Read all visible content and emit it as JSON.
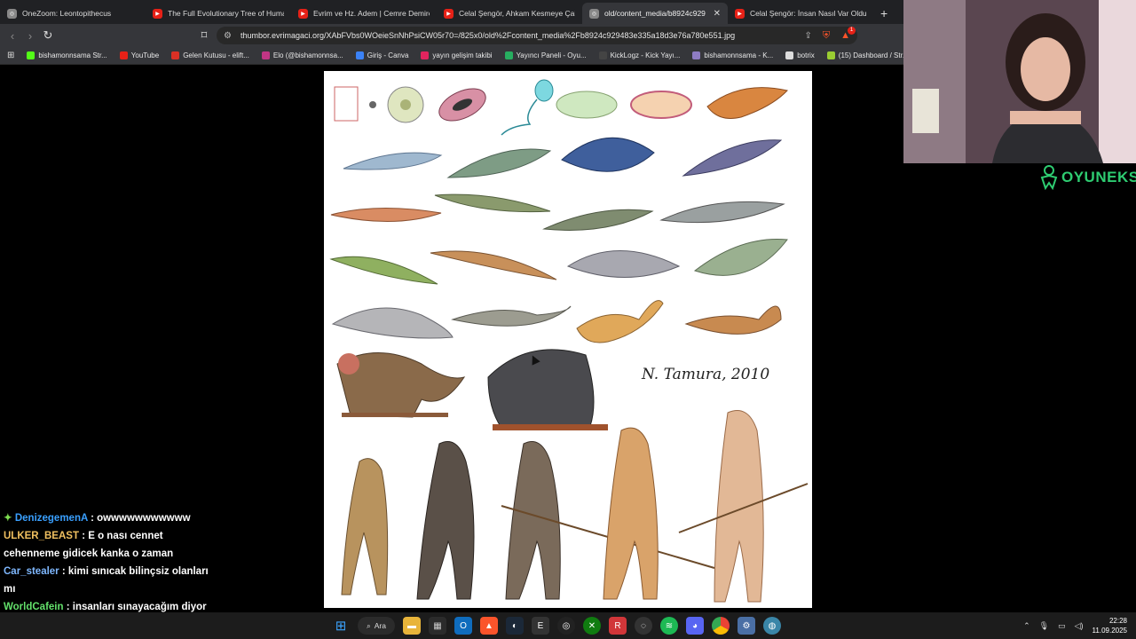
{
  "browser": {
    "tabs": [
      {
        "title": "OneZoom: Leontopithecus",
        "favicon": "onezoom-icon",
        "color": "#888888",
        "active": false
      },
      {
        "title": "The Full Evolutionary Tree of Human",
        "favicon": "youtube-icon",
        "color": "#e62117",
        "active": false
      },
      {
        "title": "Evrim ve Hz. Adem | Cemre Demirel",
        "favicon": "youtube-icon",
        "color": "#e62117",
        "active": false
      },
      {
        "title": "Celal Şengör, Ahkam Kesmeye Çalış",
        "favicon": "youtube-icon",
        "color": "#e62117",
        "active": false
      },
      {
        "title": "old/content_media/b8924c929",
        "favicon": "globe-icon",
        "color": "#888888",
        "active": true
      },
      {
        "title": "Celal Şengör: İnsan Nasıl Var Oldu?",
        "favicon": "youtube-icon",
        "color": "#e62117",
        "active": false
      }
    ],
    "url": "thumbor.evrimagaci.org/XAbFVbs0WOeieSnNhPsiCW05r70=/825x0/old%2Fcontent_media%2Fb8924c929483e335a18d3e76a780e551.jpg",
    "brave_badge": "1",
    "bookmarks": [
      {
        "label": "bishamonnsama Str...",
        "icon": "kick-icon",
        "color": "#53fc18"
      },
      {
        "label": "YouTube",
        "icon": "youtube-icon",
        "color": "#e62117"
      },
      {
        "label": "Gelen Kutusu - elift...",
        "icon": "gmail-icon",
        "color": "#d93025"
      },
      {
        "label": "Elo (@bishamonnsa...",
        "icon": "instagram-icon",
        "color": "#c13584"
      },
      {
        "label": "Giriş - Canva",
        "icon": "canva-icon",
        "color": "#3b82f6"
      },
      {
        "label": "yayın gelişim takibi",
        "icon": "heart-icon",
        "color": "#e0245e"
      },
      {
        "label": "Yayıncı Paneli - Oyu...",
        "icon": "person-icon",
        "color": "#27ae60"
      },
      {
        "label": "KickLogz - Kick Yayı...",
        "icon": "kicklogz-icon",
        "color": "#444444"
      },
      {
        "label": "bishamonnsama - K...",
        "icon": "eye-icon",
        "color": "#8e7cc3"
      },
      {
        "label": "botrix",
        "icon": "diamond-icon",
        "color": "#dddddd"
      },
      {
        "label": "(15) Dashboard / Str...",
        "icon": "dashboard-icon",
        "color": "#9acd32"
      }
    ]
  },
  "image": {
    "signature": "N. Tamura, 2010"
  },
  "chat": [
    {
      "user": "DenizegemenA",
      "color": "#3aa0ff",
      "badge": "✦",
      "message": ": owwwwwwwwwww"
    },
    {
      "user": "ULKER_BEAST",
      "color": "#f0c060",
      "badge": "",
      "message": ": E o nası cennet cehenneme gidicek kanka o zaman"
    },
    {
      "user": "Car_stealer",
      "color": "#7fb8ff",
      "badge": "",
      "message": ": kimi sınıcak bilinçsiz olanları mı"
    },
    {
      "user": "WorldCafein",
      "color": "#63e06b",
      "badge": "",
      "message": ": insanları sınayacağım diyor"
    }
  ],
  "overlay": {
    "logo_text": "OYUNEKS"
  },
  "taskbar": {
    "search_label": "Ara",
    "time": "22:28",
    "date": "11.09.2025"
  }
}
